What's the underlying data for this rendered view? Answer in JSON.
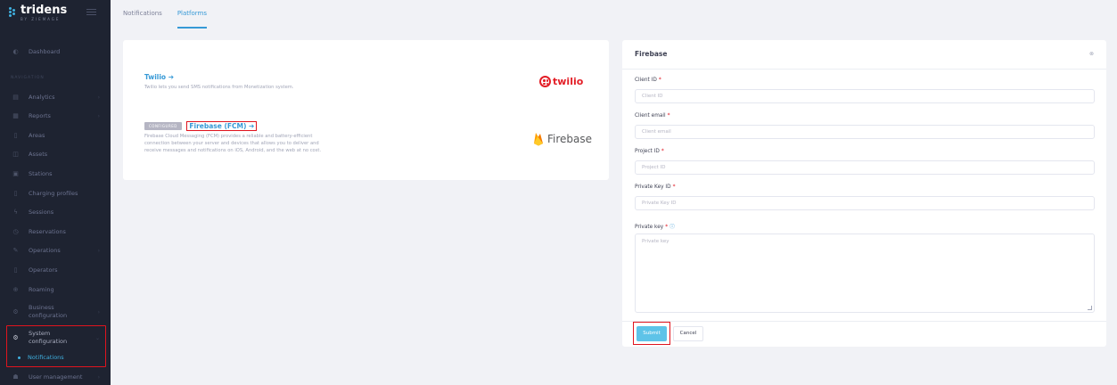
{
  "brand": {
    "name": "tridens",
    "tagline": "BY ZIEMAGE"
  },
  "sidebar": {
    "section_title": "NAVIGATION",
    "items": [
      {
        "label": "Dashboard",
        "icon": "dashboard-icon"
      },
      {
        "label": "Analytics",
        "icon": "analytics-icon"
      },
      {
        "label": "Reports",
        "icon": "reports-icon"
      },
      {
        "label": "Areas",
        "icon": "areas-icon"
      },
      {
        "label": "Assets",
        "icon": "assets-icon"
      },
      {
        "label": "Stations",
        "icon": "stations-icon"
      },
      {
        "label": "Charging profiles",
        "icon": "charging-profiles-icon"
      },
      {
        "label": "Sessions",
        "icon": "sessions-icon"
      },
      {
        "label": "Reservations",
        "icon": "reservations-icon"
      },
      {
        "label": "Operations",
        "icon": "operations-icon"
      },
      {
        "label": "Operators",
        "icon": "operators-icon"
      },
      {
        "label": "Roaming",
        "icon": "roaming-icon"
      },
      {
        "label_1": "Business",
        "label_2": "configuration",
        "icon": "business-config-icon"
      },
      {
        "label_1": "System",
        "label_2": "configuration",
        "icon": "system-config-icon"
      },
      {
        "label": "Notifications",
        "active": true
      },
      {
        "label": "User management",
        "icon": "user-management-icon"
      }
    ]
  },
  "tabs": [
    {
      "label": "Notifications",
      "active": false
    },
    {
      "label": "Platforms",
      "active": true
    }
  ],
  "platforms": {
    "twilio": {
      "link": "Twilio ➔",
      "description": "Twilio lets you send SMS notifications from Monetization system.",
      "logo_text": "twilio"
    },
    "firebase": {
      "badge": "CONFIGURED",
      "link": "Firebase (FCM) ➔",
      "description_1": "Firebase Cloud Messaging (FCM) provides a reliable and battery-efficient",
      "description_2": "connection between your server and devices that allows you to deliver and",
      "description_3": "receive messages and notifications on iOS, Android, and the web at no cost.",
      "logo_text": "Firebase"
    }
  },
  "form": {
    "title": "Firebase",
    "close_icon": "close-icon",
    "fields": {
      "client_id": {
        "label": "Client ID",
        "placeholder": "Client ID"
      },
      "client_email": {
        "label": "Client email",
        "placeholder": "Client email"
      },
      "project_id": {
        "label": "Project ID",
        "placeholder": "Project ID"
      },
      "private_key_id": {
        "label": "Private Key ID",
        "placeholder": "Private Key ID"
      },
      "private_key": {
        "label": "Private key",
        "placeholder": "Private key"
      }
    },
    "required_mark": "*",
    "info_mark": "ⓘ",
    "submit_label": "Submit",
    "cancel_label": "Cancel"
  },
  "colors": {
    "accent": "#3699d6",
    "sidebar_bg": "#1e2331",
    "highlight": "#e0141e",
    "submit_bg": "#5ec3e8"
  }
}
